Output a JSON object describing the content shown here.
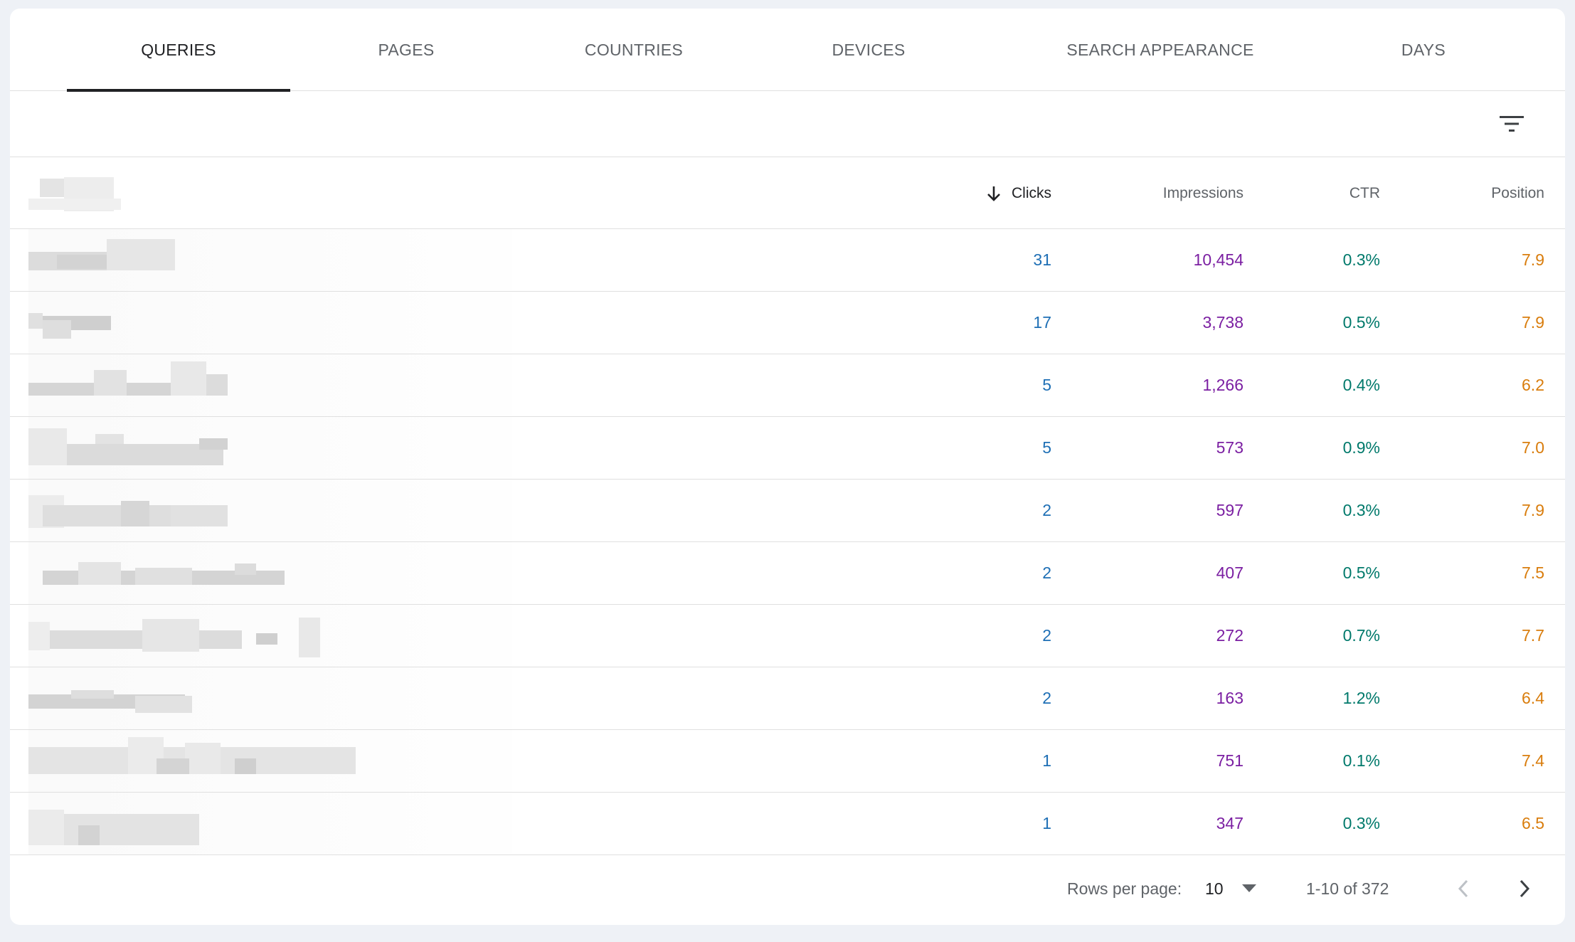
{
  "tabs": [
    {
      "label": "QUERIES",
      "active": true
    },
    {
      "label": "PAGES",
      "active": false
    },
    {
      "label": "COUNTRIES",
      "active": false
    },
    {
      "label": "DEVICES",
      "active": false
    },
    {
      "label": "SEARCH APPEARANCE",
      "active": false
    },
    {
      "label": "DAYS",
      "active": false
    }
  ],
  "filter": {
    "icon": "filter-icon"
  },
  "table": {
    "sort_icon": "arrow-down-icon",
    "headers": {
      "clicks": "Clicks",
      "impressions": "Impressions",
      "ctr": "CTR",
      "position": "Position"
    },
    "rows": [
      {
        "clicks": "31",
        "impressions": "10,454",
        "ctr": "0.3%",
        "position": "7.9"
      },
      {
        "clicks": "17",
        "impressions": "3,738",
        "ctr": "0.5%",
        "position": "7.9"
      },
      {
        "clicks": "5",
        "impressions": "1,266",
        "ctr": "0.4%",
        "position": "6.2"
      },
      {
        "clicks": "5",
        "impressions": "573",
        "ctr": "0.9%",
        "position": "7.0"
      },
      {
        "clicks": "2",
        "impressions": "597",
        "ctr": "0.3%",
        "position": "7.9"
      },
      {
        "clicks": "2",
        "impressions": "407",
        "ctr": "0.5%",
        "position": "7.5"
      },
      {
        "clicks": "2",
        "impressions": "272",
        "ctr": "0.7%",
        "position": "7.7"
      },
      {
        "clicks": "2",
        "impressions": "163",
        "ctr": "1.2%",
        "position": "6.4"
      },
      {
        "clicks": "1",
        "impressions": "751",
        "ctr": "0.1%",
        "position": "7.4"
      },
      {
        "clicks": "1",
        "impressions": "347",
        "ctr": "0.3%",
        "position": "6.5"
      }
    ]
  },
  "footer": {
    "rows_per_page_label": "Rows per page:",
    "rows_per_page_value": "10",
    "range": "1-10 of 372",
    "prev_icon": "chevron-left-icon",
    "next_icon": "chevron-right-icon"
  },
  "colors": {
    "clicks": "#1e6fb5",
    "impressions": "#7b1fa2",
    "ctr": "#00796b",
    "position": "#d97d0d"
  }
}
